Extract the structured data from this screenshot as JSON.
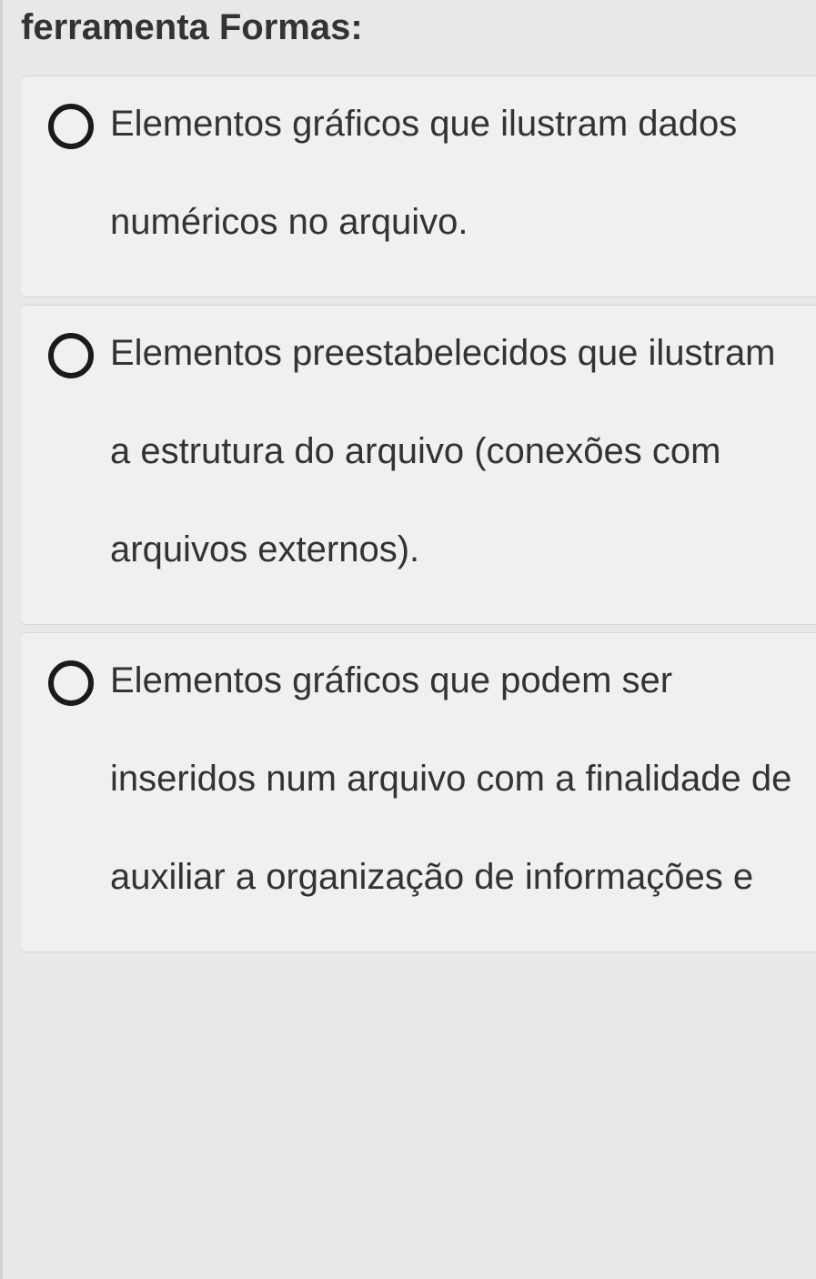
{
  "question": {
    "title": "ferramenta Formas:"
  },
  "options": [
    {
      "text": "Elementos gráficos que ilustram dados numéricos no arquivo."
    },
    {
      "text": "Elementos preestabelecidos que ilustram a estrutura do arquivo (conexões com arquivos externos)."
    },
    {
      "text": "Elementos gráficos que podem ser inseridos num arquivo com a finalidade de auxiliar a organização de informações e"
    }
  ]
}
